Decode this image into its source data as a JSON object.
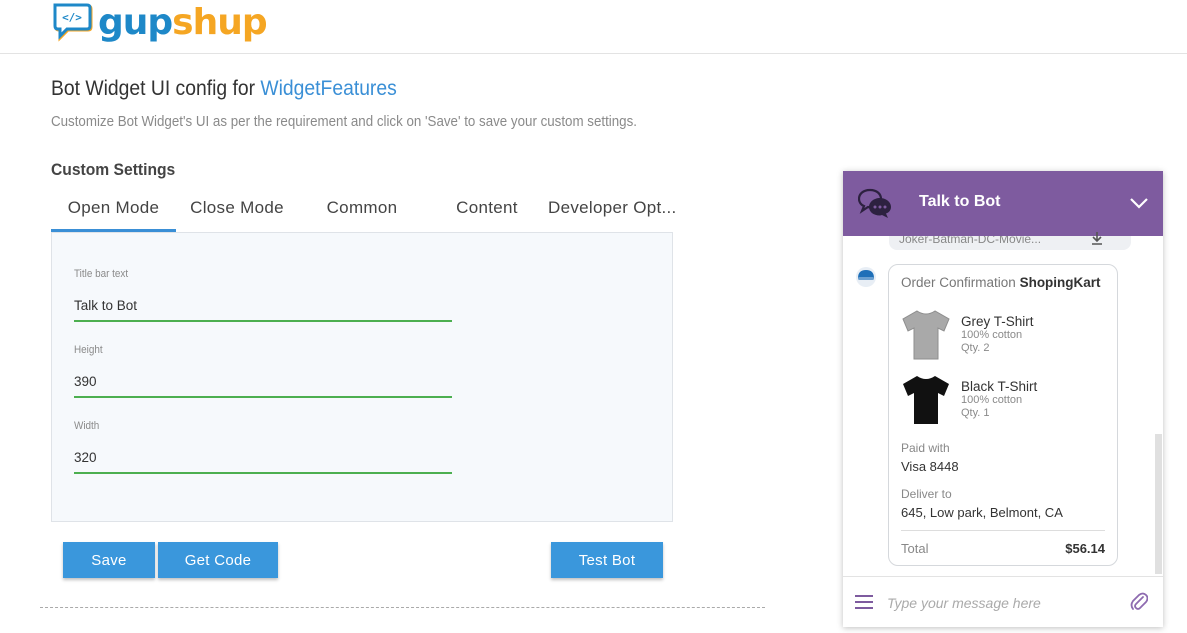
{
  "brand": {
    "name_part1": "gup",
    "name_part2": "shup",
    "icon_text": "</>"
  },
  "page": {
    "title_prefix": "Bot Widget UI config for ",
    "bot_name": "WidgetFeatures",
    "subtitle": "Customize Bot Widget's UI as per the requirement and click on 'Save' to save your custom settings.",
    "section_title": "Custom Settings"
  },
  "tabs": [
    {
      "label": "Open Mode",
      "active": true
    },
    {
      "label": "Close Mode",
      "active": false
    },
    {
      "label": "Common",
      "active": false
    },
    {
      "label": "Content",
      "active": false
    },
    {
      "label": "Developer Opt...",
      "active": false
    }
  ],
  "fields": [
    {
      "label": "Title bar text",
      "value": "Talk to Bot"
    },
    {
      "label": "Height",
      "value": "390"
    },
    {
      "label": "Width",
      "value": "320"
    }
  ],
  "buttons": {
    "save": "Save",
    "get_code": "Get Code",
    "test_bot": "Test Bot"
  },
  "widget": {
    "title": "Talk to Bot",
    "header_color": "#7e5b9f",
    "previous_item": "Joker-Batman-DC-Movie...",
    "order": {
      "title": "Order Confirmation",
      "merchant": "ShopingKart",
      "items": [
        {
          "name": "Grey T-Shirt",
          "material": "100% cotton",
          "qty": "Qty. 2",
          "color": "#a9a9a9"
        },
        {
          "name": "Black T-Shirt",
          "material": "100% cotton",
          "qty": "Qty. 1",
          "color": "#111111"
        }
      ],
      "paid_label": "Paid with",
      "paid_value": "Visa 8448",
      "deliver_label": "Deliver to",
      "deliver_value": "645, Low park, Belmont, CA",
      "total_label": "Total",
      "total_value": "$56.14"
    },
    "input_placeholder": "Type your message here"
  },
  "colors": {
    "accent": "#3a8fd6",
    "button": "#3a97dc",
    "field_underline": "#4caf50"
  }
}
